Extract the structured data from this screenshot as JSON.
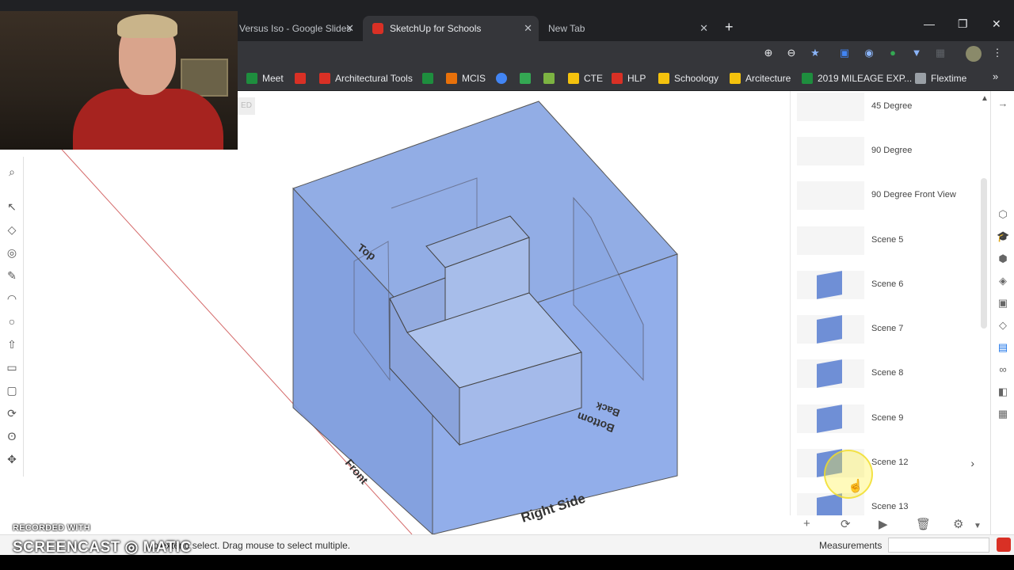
{
  "browser": {
    "tabs": [
      {
        "title": "Versus Iso - Google Slides"
      },
      {
        "title": "SketchUp for Schools",
        "active": true
      },
      {
        "title": "New Tab"
      }
    ],
    "bookmarks": [
      {
        "label": "Meet",
        "color": "#1e8e3e"
      },
      {
        "label": "",
        "color": "#d93025"
      },
      {
        "label": "Architectural Tools",
        "color": "#d93025"
      },
      {
        "label": "",
        "color": "#1e8e3e"
      },
      {
        "label": "MCIS",
        "color": "#e8710a"
      },
      {
        "label": "",
        "color": "#4285f4"
      },
      {
        "label": "",
        "color": "#34a853"
      },
      {
        "label": "",
        "color": "#7cb342"
      },
      {
        "label": "CTE",
        "color": "#f4c20d"
      },
      {
        "label": "HLP",
        "color": "#d93025"
      },
      {
        "label": "Schoology",
        "color": "#f4c20d"
      },
      {
        "label": "Arcitecture",
        "color": "#f4c20d"
      },
      {
        "label": "2019 MILEAGE EXP...",
        "color": "#1e8e3e"
      },
      {
        "label": "Flextime",
        "color": "#9aa0a6"
      }
    ]
  },
  "canvas": {
    "labels": {
      "top": "Top",
      "front": "Front",
      "right_side": "Right Side",
      "bottom": "Bottom",
      "back": "Back"
    }
  },
  "scenes_panel": {
    "scenes": [
      {
        "name": "45 Degree"
      },
      {
        "name": "90 Degree"
      },
      {
        "name": "90 Degree Front View"
      },
      {
        "name": "Scene 5"
      },
      {
        "name": "Scene 6"
      },
      {
        "name": "Scene 7"
      },
      {
        "name": "Scene 8"
      },
      {
        "name": "Scene 9"
      },
      {
        "name": "Scene 12",
        "selected": true
      },
      {
        "name": "Scene 13"
      }
    ]
  },
  "status": {
    "hint": "to extend select. Drag mouse to select multiple.",
    "measurements_label": "Measurements",
    "measurements_value": ""
  },
  "watermark": {
    "line1": "RECORDED WITH",
    "line2": "SCREENCAST ◎ MATIC"
  }
}
